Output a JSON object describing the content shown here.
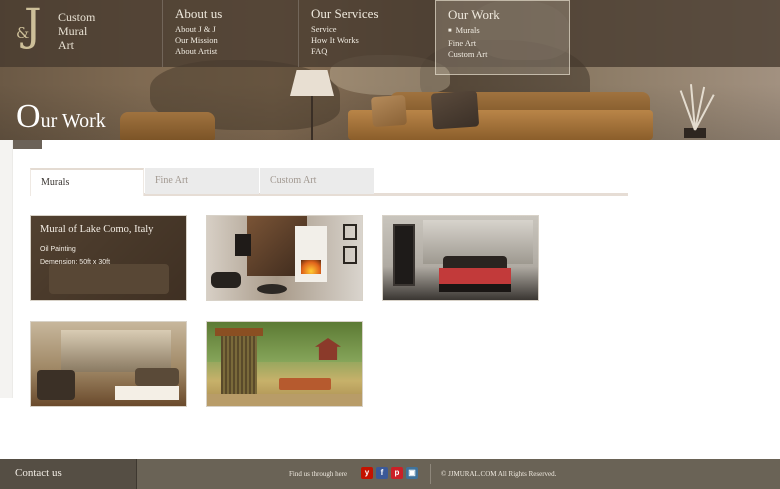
{
  "brand": {
    "monogram_amp": "&",
    "monogram_letter": "J",
    "name_lines": [
      "Custom",
      "Mural",
      "Art"
    ]
  },
  "nav": {
    "about": {
      "title": "About us",
      "links": [
        "About J & J",
        "Our Mission",
        "About Artist"
      ]
    },
    "services": {
      "title": "Our Services",
      "links": [
        "Service",
        "How It Works",
        "FAQ"
      ]
    },
    "work": {
      "title": "Our Work",
      "links": [
        "Murals",
        "Fine Art",
        "Custom Art"
      ],
      "active_link": "Murals"
    }
  },
  "hero": {
    "title_initial": "O",
    "title_rest": "ur Work"
  },
  "tabs": [
    {
      "label": "Murals",
      "active": true
    },
    {
      "label": "Fine Art",
      "active": false
    },
    {
      "label": "Custom Art",
      "active": false
    }
  ],
  "gallery": {
    "featured": {
      "title": "Mural of Lake Como, Italy",
      "medium": "Oil Painting",
      "dimension": "Demension: 50ft x 30ft"
    },
    "items": [
      {
        "icon": "living-room-mural-image"
      },
      {
        "icon": "fireplace-mural-image"
      },
      {
        "icon": "bedroom-mural-image"
      },
      {
        "icon": "lounge-mural-image"
      },
      {
        "icon": "garden-pavilion-mural-image"
      }
    ]
  },
  "footer": {
    "contact": "Contact us",
    "find_us": "Find us through here",
    "social": [
      {
        "name": "yelp",
        "glyph": "y",
        "color": "#c41200"
      },
      {
        "name": "facebook",
        "glyph": "f",
        "color": "#3b5998"
      },
      {
        "name": "pinterest",
        "glyph": "p",
        "color": "#cb2027"
      },
      {
        "name": "instagram",
        "glyph": "▣",
        "color": "#3f729b"
      }
    ],
    "copyright": "© JJMURAL.COM All Rights Reserved."
  }
}
